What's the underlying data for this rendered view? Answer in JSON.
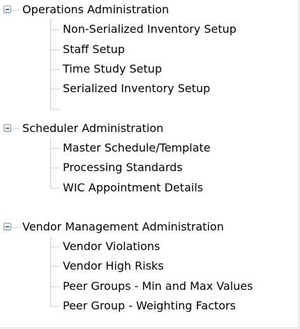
{
  "tree": {
    "groups": [
      {
        "label": "Operations Administration",
        "expanded": true,
        "children": [
          "Non-Serialized Inventory Setup",
          "Staff Setup",
          "Time Study Setup",
          "Serialized Inventory Setup"
        ]
      },
      {
        "label": "Scheduler Administration",
        "expanded": true,
        "children": [
          "Master Schedule/Template",
          "Processing Standards",
          "WIC Appointment Details"
        ]
      },
      {
        "label": "Vendor Management Administration",
        "expanded": true,
        "children": [
          "Vendor Violations",
          "Vendor High Risks",
          "Peer Groups - Min and Max Values",
          "Peer Group - Weighting Factors"
        ]
      }
    ]
  },
  "colors": {
    "background": "#ffffff",
    "text": "#000000",
    "tree_line": "#a0a0a0",
    "toggle_border": "#7f9db9"
  },
  "icons": {
    "collapse_toggle": "minus-box-icon"
  }
}
